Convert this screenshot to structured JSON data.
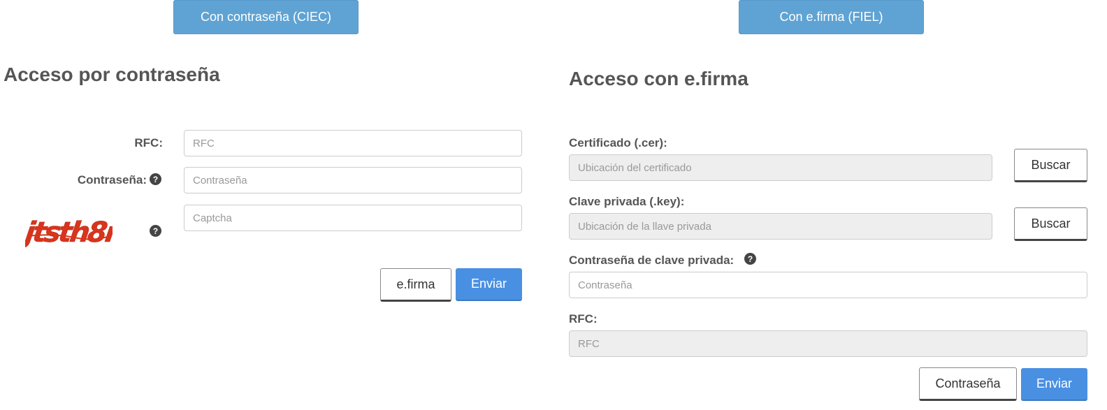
{
  "tabs": {
    "ciec_label": "Con contraseña (CIEC)",
    "fiel_label": "Con e.firma (FIEL)"
  },
  "password_access": {
    "title": "Acceso por contraseña",
    "rfc_label": "RFC:",
    "rfc_placeholder": "RFC",
    "password_label": "Contraseña:",
    "password_placeholder": "Contraseña",
    "captcha_placeholder": "Captcha",
    "captcha_text": "jtsth8r",
    "efirma_button": "e.firma",
    "submit_button": "Enviar"
  },
  "efirma_access": {
    "title": "Acceso con e.firma",
    "cert_label": "Certificado (.cer):",
    "cert_placeholder": "Ubicación del certificado",
    "cert_browse": "Buscar",
    "key_label": "Clave privada (.key):",
    "key_placeholder": "Ubicación de la llave privada",
    "key_browse": "Buscar",
    "key_password_label": "Contraseña de clave privada:",
    "key_password_placeholder": "Contraseña",
    "rfc_label": "RFC:",
    "rfc_placeholder": "RFC",
    "password_button": "Contraseña",
    "submit_button": "Enviar"
  },
  "colors": {
    "tab_blue": "#5fa3d4",
    "submit_blue": "#4a90e2",
    "captcha_red": "#d9341c"
  },
  "icons": {
    "help": "question-circle-icon"
  }
}
